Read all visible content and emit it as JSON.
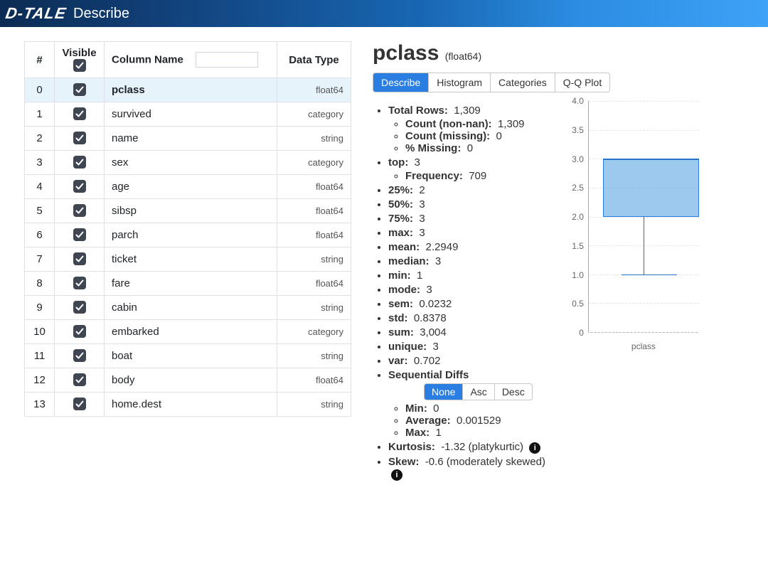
{
  "header": {
    "logo": "D-TALE",
    "title": "Describe"
  },
  "table": {
    "headers": {
      "idx": "#",
      "visible": "Visible",
      "colname": "Column Name",
      "dtype": "Data Type"
    },
    "filter_placeholder": "",
    "rows": [
      {
        "i": "0",
        "name": "pclass",
        "dtype": "float64",
        "selected": true
      },
      {
        "i": "1",
        "name": "survived",
        "dtype": "category",
        "selected": false
      },
      {
        "i": "2",
        "name": "name",
        "dtype": "string",
        "selected": false
      },
      {
        "i": "3",
        "name": "sex",
        "dtype": "category",
        "selected": false
      },
      {
        "i": "4",
        "name": "age",
        "dtype": "float64",
        "selected": false
      },
      {
        "i": "5",
        "name": "sibsp",
        "dtype": "float64",
        "selected": false
      },
      {
        "i": "6",
        "name": "parch",
        "dtype": "float64",
        "selected": false
      },
      {
        "i": "7",
        "name": "ticket",
        "dtype": "string",
        "selected": false
      },
      {
        "i": "8",
        "name": "fare",
        "dtype": "float64",
        "selected": false
      },
      {
        "i": "9",
        "name": "cabin",
        "dtype": "string",
        "selected": false
      },
      {
        "i": "10",
        "name": "embarked",
        "dtype": "category",
        "selected": false
      },
      {
        "i": "11",
        "name": "boat",
        "dtype": "string",
        "selected": false
      },
      {
        "i": "12",
        "name": "body",
        "dtype": "float64",
        "selected": false
      },
      {
        "i": "13",
        "name": "home.dest",
        "dtype": "string",
        "selected": false
      }
    ]
  },
  "details": {
    "column": "pclass",
    "dtype_paren": "(float64)",
    "tabs": [
      {
        "label": "Describe",
        "active": true
      },
      {
        "label": "Histogram",
        "active": false
      },
      {
        "label": "Categories",
        "active": false
      },
      {
        "label": "Q-Q Plot",
        "active": false
      }
    ],
    "labels": {
      "total_rows": "Total Rows:",
      "count_nonnan": "Count (non-nan):",
      "count_missing": "Count (missing):",
      "pct_missing": "% Missing:",
      "top": "top:",
      "frequency": "Frequency:",
      "p25": "25%:",
      "p50": "50%:",
      "p75": "75%:",
      "max": "max:",
      "mean": "mean:",
      "median": "median:",
      "min": "min:",
      "mode": "mode:",
      "sem": "sem:",
      "std": "std:",
      "sum": "sum:",
      "unique": "unique:",
      "var": "var:",
      "seq": "Sequential Diffs",
      "seq_min": "Min:",
      "seq_avg": "Average:",
      "seq_max": "Max:",
      "kurtosis": "Kurtosis:",
      "skew": "Skew:"
    },
    "values": {
      "total_rows": "1,309",
      "count_nonnan": "1,309",
      "count_missing": "0",
      "pct_missing": "0",
      "top": "3",
      "frequency": "709",
      "p25": "2",
      "p50": "3",
      "p75": "3",
      "max": "3",
      "mean": "2.2949",
      "median": "3",
      "min": "1",
      "mode": "3",
      "sem": "0.0232",
      "std": "0.8378",
      "sum": "3,004",
      "unique": "3",
      "var": "0.702",
      "seq_min": "0",
      "seq_avg": "0.001529",
      "seq_max": "1",
      "kurtosis": "-1.32 (platykurtic)",
      "skew": "-0.6 (moderately skewed)"
    },
    "seq_buttons": [
      {
        "label": "None",
        "active": true
      },
      {
        "label": "Asc",
        "active": false
      },
      {
        "label": "Desc",
        "active": false
      }
    ]
  },
  "chart_data": {
    "type": "box",
    "xlabel": "pclass",
    "ylim": [
      0,
      4
    ],
    "yticks": [
      0,
      0.5,
      1.0,
      1.5,
      2.0,
      2.5,
      3.0,
      3.5,
      4.0
    ],
    "box": {
      "min": 1,
      "q1": 2,
      "median": 3,
      "q3": 3,
      "max": 3
    }
  }
}
